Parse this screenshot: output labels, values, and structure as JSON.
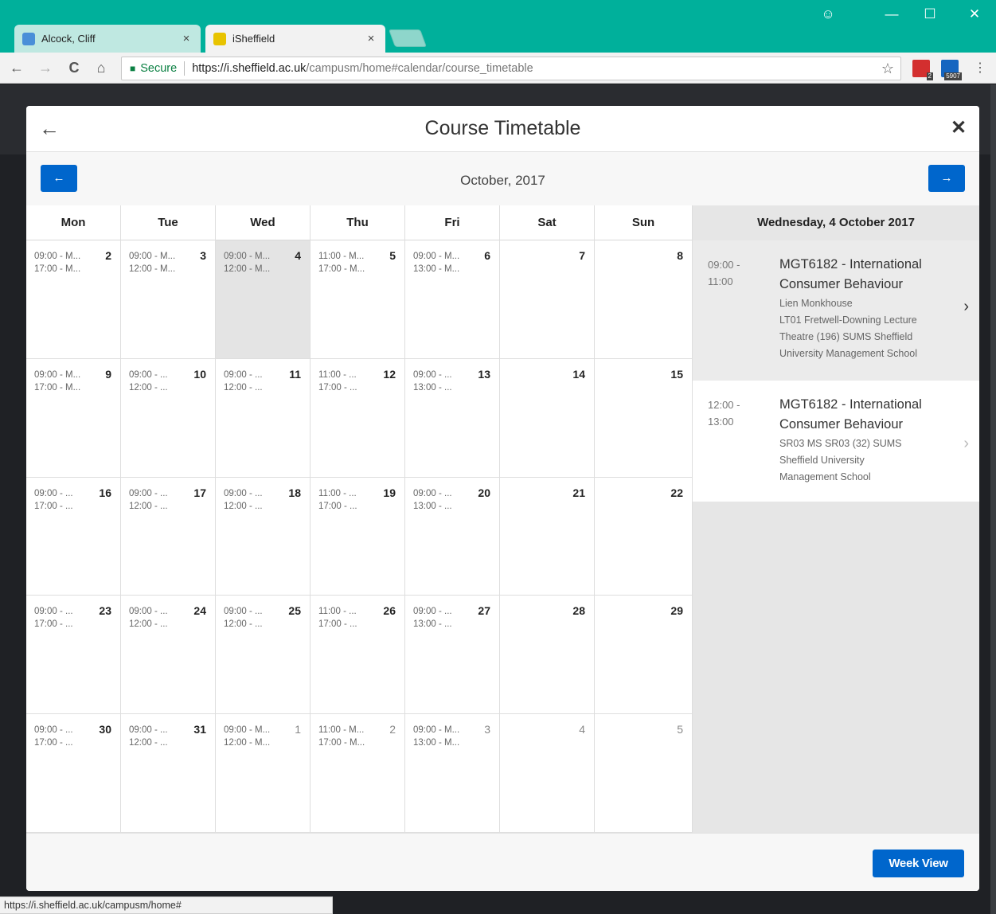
{
  "browser": {
    "tabs": [
      {
        "title": "Alcock, Cliff",
        "favicon_color": "#4a8fd8",
        "close": "×",
        "active": false
      },
      {
        "title": "iSheffield",
        "favicon_color": "#e8c300",
        "close": "×",
        "active": true
      }
    ],
    "window_controls": {
      "account": "☺",
      "minimize": "—",
      "maximize": "☐",
      "close": "✕"
    },
    "nav": {
      "back": "←",
      "forward": "→",
      "reload": "C",
      "home": "⌂"
    },
    "address": {
      "secure_label": "Secure",
      "url_host": "https://i.sheffield.ac.uk",
      "url_path": "/campusm/home#calendar/course_timetable"
    },
    "extensions": [
      {
        "name": "ext-1",
        "badge": "2",
        "color": "#d32f2f"
      },
      {
        "name": "ext-2",
        "badge": "5907",
        "color": "#1565c0"
      }
    ],
    "menu": "⋮",
    "status_url": "https://i.sheffield.ac.uk/campusm/home#"
  },
  "modal": {
    "title": "Course Timetable",
    "back_glyph": "←",
    "close_glyph": "✕",
    "month_label": "October, 2017",
    "prev_glyph": "←",
    "next_glyph": "→",
    "week_view_label": "Week View"
  },
  "calendar": {
    "days_of_week": [
      "Mon",
      "Tue",
      "Wed",
      "Thu",
      "Fri",
      "Sat",
      "Sun"
    ],
    "weeks": [
      [
        {
          "num": "2",
          "events": [
            "09:00 - M...",
            "17:00 - M..."
          ]
        },
        {
          "num": "3",
          "events": [
            "09:00 - M...",
            "12:00 - M..."
          ]
        },
        {
          "num": "4",
          "events": [
            "09:00 - M...",
            "12:00 - M..."
          ],
          "selected": true
        },
        {
          "num": "5",
          "events": [
            "11:00 - M...",
            "17:00 - M..."
          ]
        },
        {
          "num": "6",
          "events": [
            "09:00 - M...",
            "13:00 - M..."
          ]
        },
        {
          "num": "7",
          "events": []
        },
        {
          "num": "8",
          "events": []
        }
      ],
      [
        {
          "num": "9",
          "events": [
            "09:00 - M...",
            "17:00 - M..."
          ]
        },
        {
          "num": "10",
          "events": [
            "09:00 - ...",
            "12:00 - ..."
          ]
        },
        {
          "num": "11",
          "events": [
            "09:00 - ...",
            "12:00 - ..."
          ]
        },
        {
          "num": "12",
          "events": [
            "11:00 - ...",
            "17:00 - ..."
          ]
        },
        {
          "num": "13",
          "events": [
            "09:00 - ...",
            "13:00 - ..."
          ]
        },
        {
          "num": "14",
          "events": []
        },
        {
          "num": "15",
          "events": []
        }
      ],
      [
        {
          "num": "16",
          "events": [
            "09:00 - ...",
            "17:00 - ..."
          ]
        },
        {
          "num": "17",
          "events": [
            "09:00 - ...",
            "12:00 - ..."
          ]
        },
        {
          "num": "18",
          "events": [
            "09:00 - ...",
            "12:00 - ..."
          ]
        },
        {
          "num": "19",
          "events": [
            "11:00 - ...",
            "17:00 - ..."
          ]
        },
        {
          "num": "20",
          "events": [
            "09:00 - ...",
            "13:00 - ..."
          ]
        },
        {
          "num": "21",
          "events": []
        },
        {
          "num": "22",
          "events": []
        }
      ],
      [
        {
          "num": "23",
          "events": [
            "09:00 - ...",
            "17:00 - ..."
          ]
        },
        {
          "num": "24",
          "events": [
            "09:00 - ...",
            "12:00 - ..."
          ]
        },
        {
          "num": "25",
          "events": [
            "09:00 - ...",
            "12:00 - ..."
          ]
        },
        {
          "num": "26",
          "events": [
            "11:00 - ...",
            "17:00 - ..."
          ]
        },
        {
          "num": "27",
          "events": [
            "09:00 - ...",
            "13:00 - ..."
          ]
        },
        {
          "num": "28",
          "events": []
        },
        {
          "num": "29",
          "events": []
        }
      ],
      [
        {
          "num": "30",
          "events": [
            "09:00 - ...",
            "17:00 - ..."
          ]
        },
        {
          "num": "31",
          "events": [
            "09:00 - ...",
            "12:00 - ..."
          ]
        },
        {
          "num": "1",
          "events": [
            "09:00 - M...",
            "12:00 - M..."
          ],
          "other": true
        },
        {
          "num": "2",
          "events": [
            "11:00 - M...",
            "17:00 - M..."
          ],
          "other": true
        },
        {
          "num": "3",
          "events": [
            "09:00 - M...",
            "13:00 - M..."
          ],
          "other": true
        },
        {
          "num": "4",
          "events": [],
          "other": true
        },
        {
          "num": "5",
          "events": [],
          "other": true
        }
      ]
    ]
  },
  "side_panel": {
    "heading": "Wednesday, 4 October 2017",
    "items": [
      {
        "time_start": "09:00 -",
        "time_end": "11:00",
        "title": "MGT6182 - International Consumer Behaviour",
        "lines": [
          "Lien Monkhouse",
          "LT01 Fretwell-Downing Lecture",
          "Theatre (196) SUMS Sheffield",
          "University Management School"
        ],
        "chevron": "›"
      },
      {
        "time_start": "12:00 -",
        "time_end": "13:00",
        "title": "MGT6182 - International Consumer Behaviour",
        "lines": [
          "SR03 MS SR03 (32) SUMS",
          "Sheffield University",
          "Management School"
        ],
        "chevron": "›"
      }
    ]
  }
}
